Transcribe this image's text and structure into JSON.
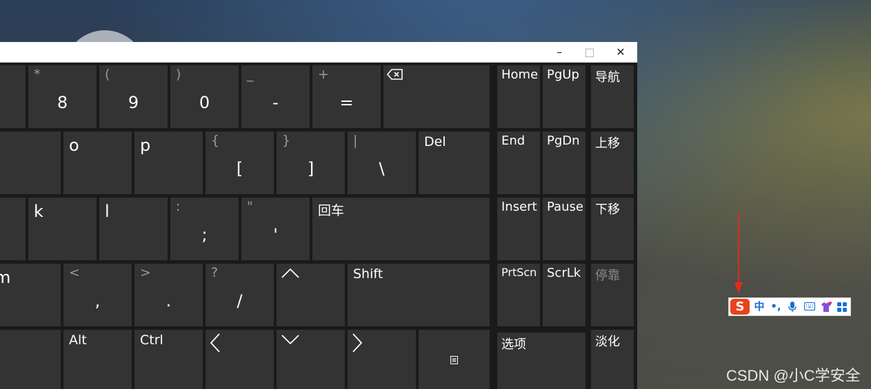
{
  "window": {
    "controls": {
      "minimize": "–",
      "maximize": "□",
      "close": "✕"
    }
  },
  "keys": {
    "row1": [
      {
        "sec": "*",
        "pri": "8"
      },
      {
        "sec": "(",
        "pri": "9"
      },
      {
        "sec": ")",
        "pri": "0"
      },
      {
        "sec": "_",
        "pri": "-"
      },
      {
        "sec": "+",
        "pri": "="
      }
    ],
    "row2": [
      {
        "label": "o"
      },
      {
        "label": "p"
      },
      {
        "sec": "{",
        "pri": "["
      },
      {
        "sec": "}",
        "pri": "]"
      },
      {
        "sec": "|",
        "pri": "\\"
      },
      {
        "label": "Del"
      }
    ],
    "row3": [
      {
        "label": "k"
      },
      {
        "label": "l"
      },
      {
        "sec": ":",
        "pri": ";"
      },
      {
        "sec": "\"",
        "pri": "'"
      },
      {
        "label": "回车"
      }
    ],
    "row4": [
      {
        "label": "m"
      },
      {
        "sec": "<",
        "pri": ","
      },
      {
        "sec": ">",
        "pri": "."
      },
      {
        "sec": "?",
        "pri": "/"
      },
      {
        "label": "Shift"
      }
    ],
    "row5": [
      {
        "label": "Alt"
      },
      {
        "label": "Ctrl"
      }
    ],
    "nav": {
      "home": "Home",
      "pgup": "PgUp",
      "nav": "导航",
      "end": "End",
      "pgdn": "PgDn",
      "moveup": "上移",
      "insert": "Insert",
      "pause": "Pause",
      "movedown": "下移",
      "prtscn": "PrtScn",
      "scrlk": "ScrLk",
      "dock": "停靠",
      "options": "选项",
      "fade": "淡化"
    }
  },
  "ime": {
    "logo": "S",
    "mode": "中",
    "punct": "•,",
    "items": [
      "mic-icon",
      "keyboard-icon",
      "skin-icon",
      "toolbox-icon"
    ]
  },
  "watermark": "CSDN @小C学安全"
}
